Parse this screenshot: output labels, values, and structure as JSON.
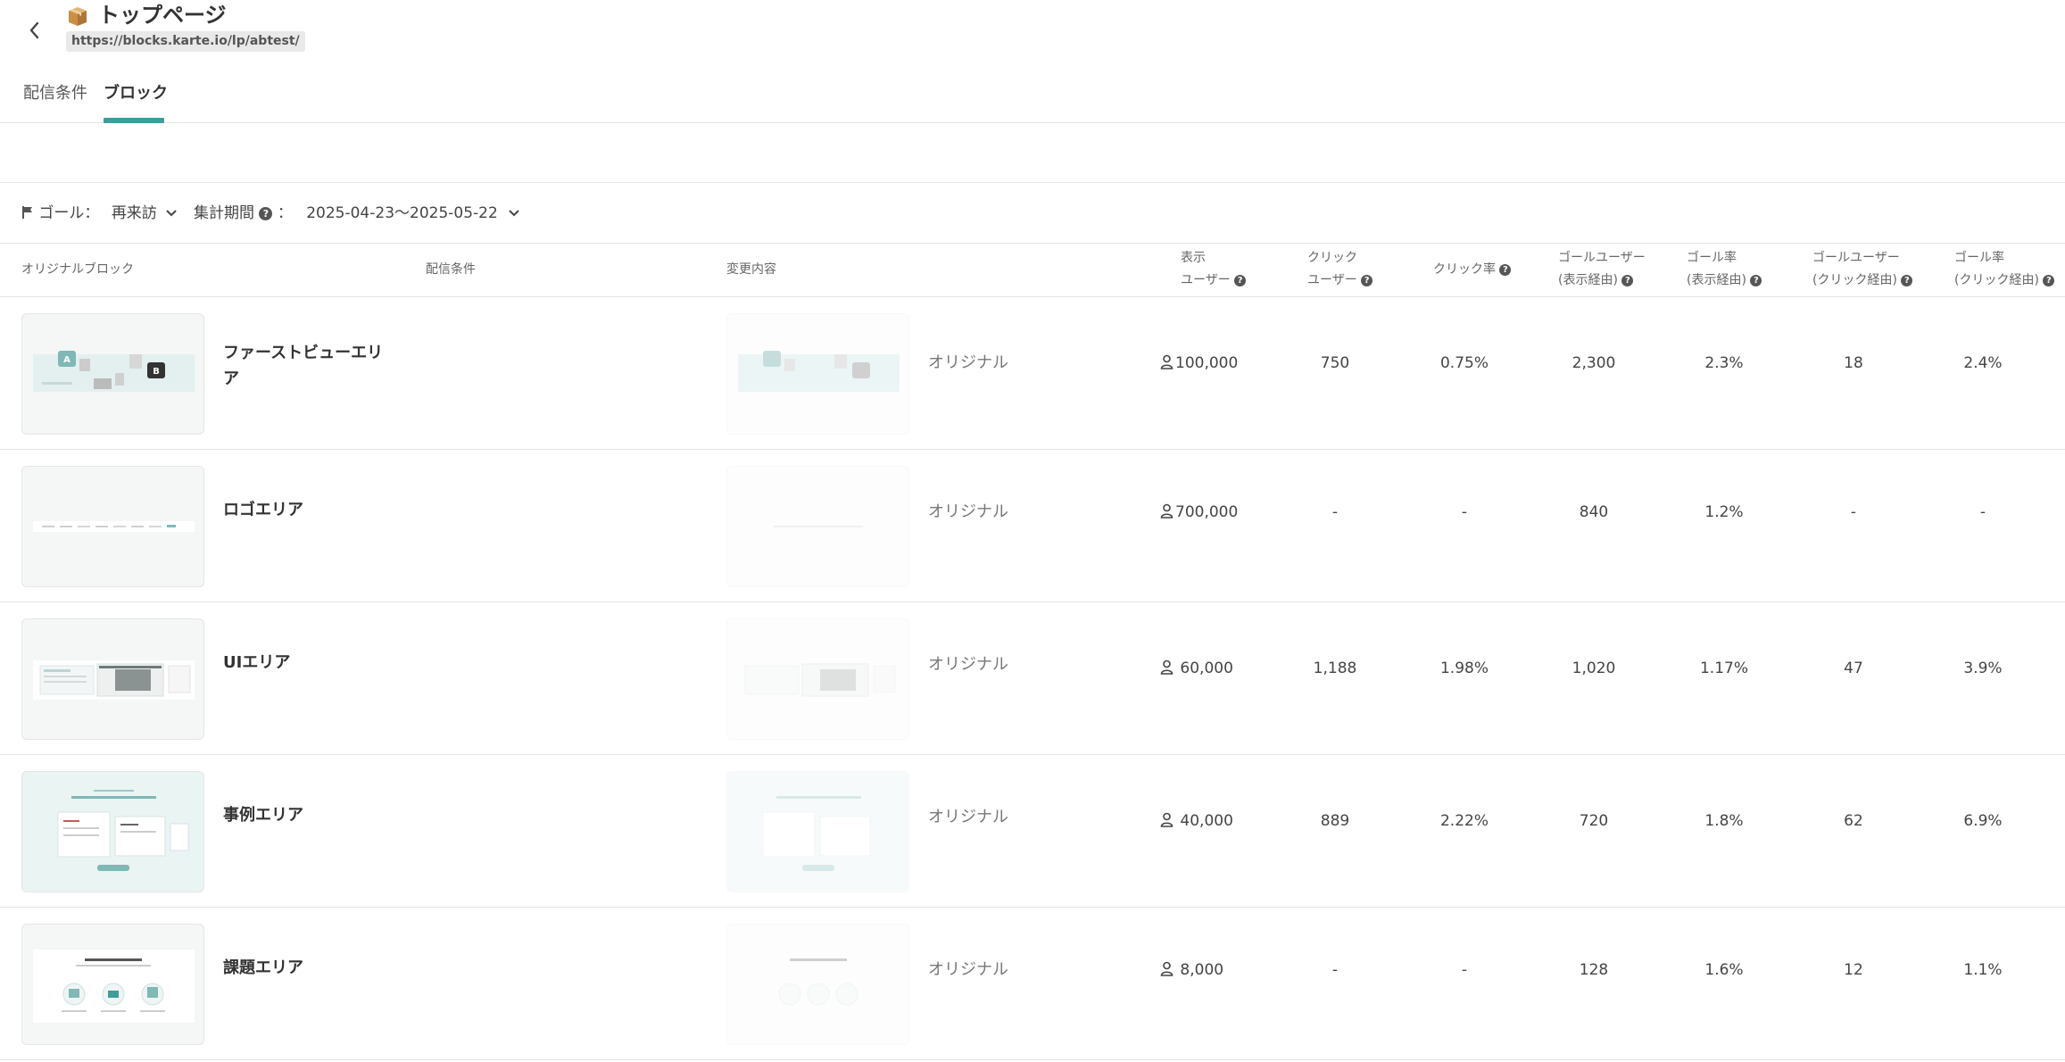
{
  "header": {
    "title": "トップページ",
    "url": "https://blocks.karte.io/lp/abtest/"
  },
  "tabs": [
    {
      "label": "配信条件"
    },
    {
      "label": "ブロック"
    }
  ],
  "filters": {
    "goal_label": "ゴール：",
    "goal_value": "再来訪",
    "period_label": "集計期間",
    "period_sep": "：",
    "period_value": "2025-04-23〜2025-05-22"
  },
  "columns": {
    "original_block": "オリジナルブロック",
    "conditions": "配信条件",
    "changes": "変更内容",
    "display_users_1": "表示",
    "display_users_2": "ユーザー",
    "click_users_1": "クリック",
    "click_users_2": "ユーザー",
    "ctr": "クリック率",
    "goal_users_display_1": "ゴールユーザー",
    "goal_users_display_2": "(表示経由)",
    "goal_rate_display_1": "ゴール率",
    "goal_rate_display_2": "(表示経由)",
    "goal_users_click_1": "ゴールユーザー",
    "goal_users_click_2": "(クリック経由)",
    "goal_rate_click_1": "ゴール率",
    "goal_rate_click_2": "(クリック経由)"
  },
  "rows": [
    {
      "name_line1": "ファーストビューエリ",
      "name_line2": "ア",
      "change": "オリジナル",
      "display_users": "100,000",
      "click_users": "750",
      "ctr": "0.75%",
      "goal_users_display": "2,300",
      "goal_rate_display": "2.3%",
      "goal_users_click": "18",
      "goal_rate_click": "2.4%"
    },
    {
      "name_line1": "ロゴエリア",
      "name_line2": "",
      "change": "オリジナル",
      "display_users": "700,000",
      "click_users": "-",
      "ctr": "-",
      "goal_users_display": "840",
      "goal_rate_display": "1.2%",
      "goal_users_click": "-",
      "goal_rate_click": "-"
    },
    {
      "name_line1": "UIエリア",
      "name_line2": "",
      "change": "オリジナル",
      "display_users": "60,000",
      "click_users": "1,188",
      "ctr": "1.98%",
      "goal_users_display": "1,020",
      "goal_rate_display": "1.17%",
      "goal_users_click": "47",
      "goal_rate_click": "3.9%"
    },
    {
      "name_line1": "事例エリア",
      "name_line2": "",
      "change": "オリジナル",
      "display_users": "40,000",
      "click_users": "889",
      "ctr": "2.22%",
      "goal_users_display": "720",
      "goal_rate_display": "1.8%",
      "goal_users_click": "62",
      "goal_rate_click": "6.9%"
    },
    {
      "name_line1": "課題エリア",
      "name_line2": "",
      "change": "オリジナル",
      "display_users": "8,000",
      "click_users": "-",
      "ctr": "-",
      "goal_users_display": "128",
      "goal_rate_display": "1.6%",
      "goal_users_click": "12",
      "goal_rate_click": "1.1%"
    }
  ],
  "colors": {
    "accent": "#3f9d9a",
    "border": "#e4e4e4"
  },
  "icons": {
    "back": "chevron-left-icon",
    "page": "box-icon",
    "goal": "flag-icon",
    "help": "question-circle-icon",
    "dropdown": "chevron-down-icon",
    "user": "person-icon"
  }
}
